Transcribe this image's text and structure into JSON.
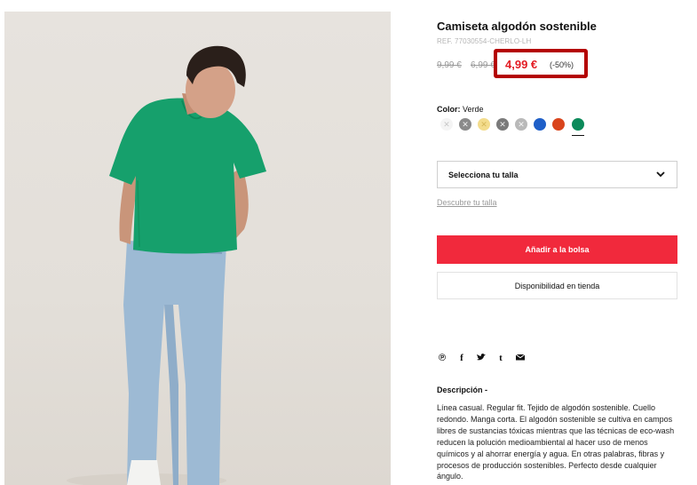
{
  "product": {
    "title": "Camiseta algodón sostenible",
    "ref": "REF. 77030554-CHERLO-LH",
    "price": {
      "original_1": "9,99 €",
      "original_2": "6,99 €",
      "current": "4,99 €",
      "discount": "(-50%)",
      "highlight_color": "#b40000",
      "current_color": "#e31b23"
    },
    "color": {
      "label": "Color:",
      "selected": "Verde",
      "swatches": [
        {
          "name": "white",
          "hex": "#f4f4f4"
        },
        {
          "name": "grey",
          "hex": "#8a8a8a"
        },
        {
          "name": "yellow",
          "hex": "#f3dc8c"
        },
        {
          "name": "dark-grey",
          "hex": "#7a7a7a"
        },
        {
          "name": "light-grey",
          "hex": "#b9b9b9"
        },
        {
          "name": "blue",
          "hex": "#1f5fc8"
        },
        {
          "name": "orange-red",
          "hex": "#d9441c"
        },
        {
          "name": "green",
          "hex": "#0c8a5a"
        }
      ]
    },
    "size_select": {
      "label": "Selecciona tu talla",
      "icon": "chevron-down-icon"
    },
    "size_guide": "Descubre tu talla",
    "add_to_bag": "Añadir a la bolsa",
    "add_to_bag_color": "#f1293c",
    "availability": "Disponibilidad en tienda",
    "share_icons": [
      "pinterest-icon",
      "facebook-icon",
      "twitter-icon",
      "tumblr-icon",
      "email-icon"
    ],
    "description": {
      "title": "Descripción -",
      "body": "Línea casual. Regular fit. Tejido de algodón sostenible. Cuello redondo. Manga corta. El algodón sostenible se cultiva en campos libres de sustancias tóxicas mientras que las técnicas de eco-wash reducen la polución medioambiental al hacer uso de menos químicos y al ahorrar energía y agua. En otras palabras, fibras y procesos de producción sostenibles. Perfecto desde cualquier ángulo."
    }
  }
}
